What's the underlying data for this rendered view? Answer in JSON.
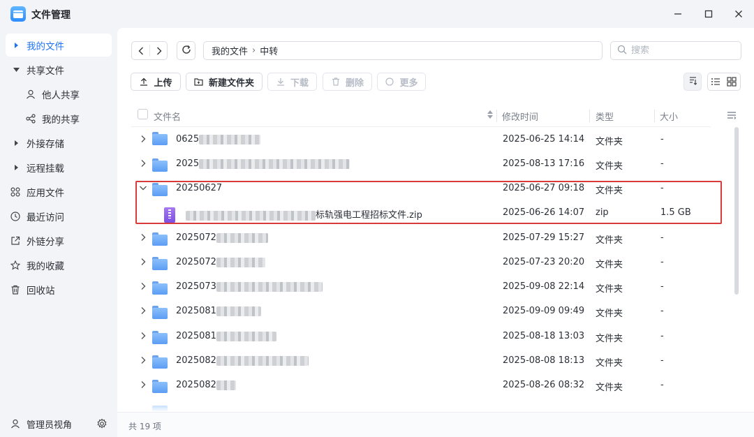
{
  "app": {
    "title": "文件管理"
  },
  "sidebar": {
    "items": [
      {
        "label": "我的文件",
        "active": true
      },
      {
        "label": "共享文件"
      },
      {
        "label": "他人共享"
      },
      {
        "label": "我的共享"
      },
      {
        "label": "外接存储"
      },
      {
        "label": "远程挂载"
      },
      {
        "label": "应用文件"
      },
      {
        "label": "最近访问"
      },
      {
        "label": "外链分享"
      },
      {
        "label": "我的收藏"
      },
      {
        "label": "回收站"
      }
    ],
    "footer_label": "管理员视角"
  },
  "toolbar": {
    "path": [
      "我的文件",
      "中转"
    ],
    "search_placeholder": "搜索",
    "upload": "上传",
    "new_folder": "新建文件夹",
    "download": "下载",
    "delete": "删除",
    "more": "更多"
  },
  "table": {
    "headers": {
      "name": "文件名",
      "modified": "修改时间",
      "type": "类型",
      "size": "大小"
    },
    "rows": [
      {
        "name_prefix": "0625",
        "modified": "2025-06-25 14:14",
        "type": "文件夹",
        "size": "-"
      },
      {
        "name_prefix": "2025",
        "modified": "2025-08-13 17:16",
        "type": "文件夹",
        "size": "-"
      },
      {
        "name_prefix": "20250627",
        "modified": "2025-06-27 09:18",
        "type": "文件夹",
        "size": "-"
      },
      {
        "name_suffix": "标轨强电工程招标文件.zip",
        "modified": "2025-06-26 14:07",
        "type": "zip",
        "size": "1.5 GB"
      },
      {
        "name_prefix": "2025072",
        "modified": "2025-07-29 15:27",
        "type": "文件夹",
        "size": "-"
      },
      {
        "name_prefix": "2025072",
        "modified": "2025-07-23 20:20",
        "type": "文件夹",
        "size": "-"
      },
      {
        "name_prefix": "2025073",
        "modified": "2025-09-08 22:14",
        "type": "文件夹",
        "size": "-"
      },
      {
        "name_prefix": "2025081",
        "modified": "2025-09-09 09:49",
        "type": "文件夹",
        "size": "-"
      },
      {
        "name_prefix": "2025081",
        "modified": "2025-08-18 13:03",
        "type": "文件夹",
        "size": "-"
      },
      {
        "name_prefix": "2025082",
        "modified": "2025-08-08 18:13",
        "type": "文件夹",
        "size": "-"
      },
      {
        "name_prefix": "2025082",
        "modified": "2025-08-26 08:32",
        "type": "文件夹",
        "size": "-"
      }
    ]
  },
  "status": {
    "count_text": "共 19 项"
  }
}
